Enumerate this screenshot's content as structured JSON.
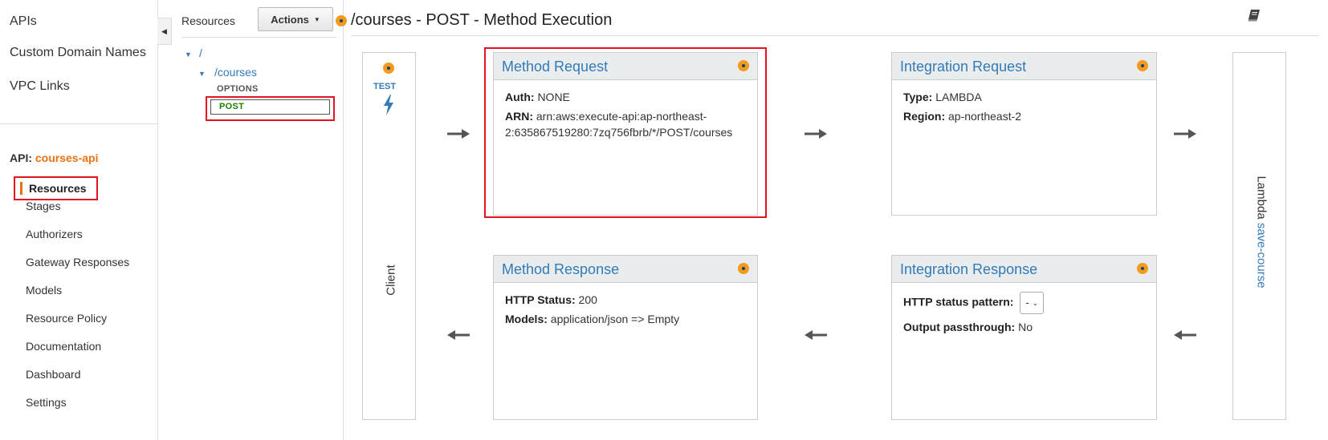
{
  "nav": {
    "top_items": [
      "APIs",
      "Custom Domain Names",
      "VPC Links"
    ],
    "api_prefix": "API:",
    "api_name": "courses-api",
    "selected": "Resources",
    "sub_items": [
      "Stages",
      "Authorizers",
      "Gateway Responses",
      "Models",
      "Resource Policy",
      "Documentation",
      "Dashboard",
      "Settings"
    ]
  },
  "resources": {
    "title": "Resources",
    "actions_label": "Actions",
    "tree": {
      "root": "/",
      "child": "/courses",
      "methods": [
        "OPTIONS",
        "POST"
      ]
    }
  },
  "execution": {
    "title": "/courses - POST - Method Execution",
    "client": {
      "test_label": "TEST",
      "label": "Client"
    },
    "method_request": {
      "title": "Method Request",
      "auth_label": "Auth:",
      "auth_value": "NONE",
      "arn_label": "ARN:",
      "arn_value_line1": "arn:aws:execute-api:ap-northeast-",
      "arn_value_line2": "2:635867519280:7zq756fbrb/*/POST/courses"
    },
    "integration_request": {
      "title": "Integration Request",
      "type_label": "Type:",
      "type_value": "LAMBDA",
      "region_label": "Region:",
      "region_value": "ap-northeast-2"
    },
    "method_response": {
      "title": "Method Response",
      "status_label": "HTTP Status:",
      "status_value": "200",
      "models_label": "Models:",
      "models_value": "application/json => Empty"
    },
    "integration_response": {
      "title": "Integration Response",
      "pattern_label": "HTTP status pattern:",
      "pattern_value": "-",
      "passthrough_label": "Output passthrough:",
      "passthrough_value": "No"
    },
    "lambda": {
      "prefix": "Lambda",
      "function_name": "save-course"
    }
  },
  "colors": {
    "accent_orange": "#ec7211",
    "link_blue": "#337ab7",
    "highlight_red": "#e3141f",
    "post_green": "#1d8102"
  }
}
